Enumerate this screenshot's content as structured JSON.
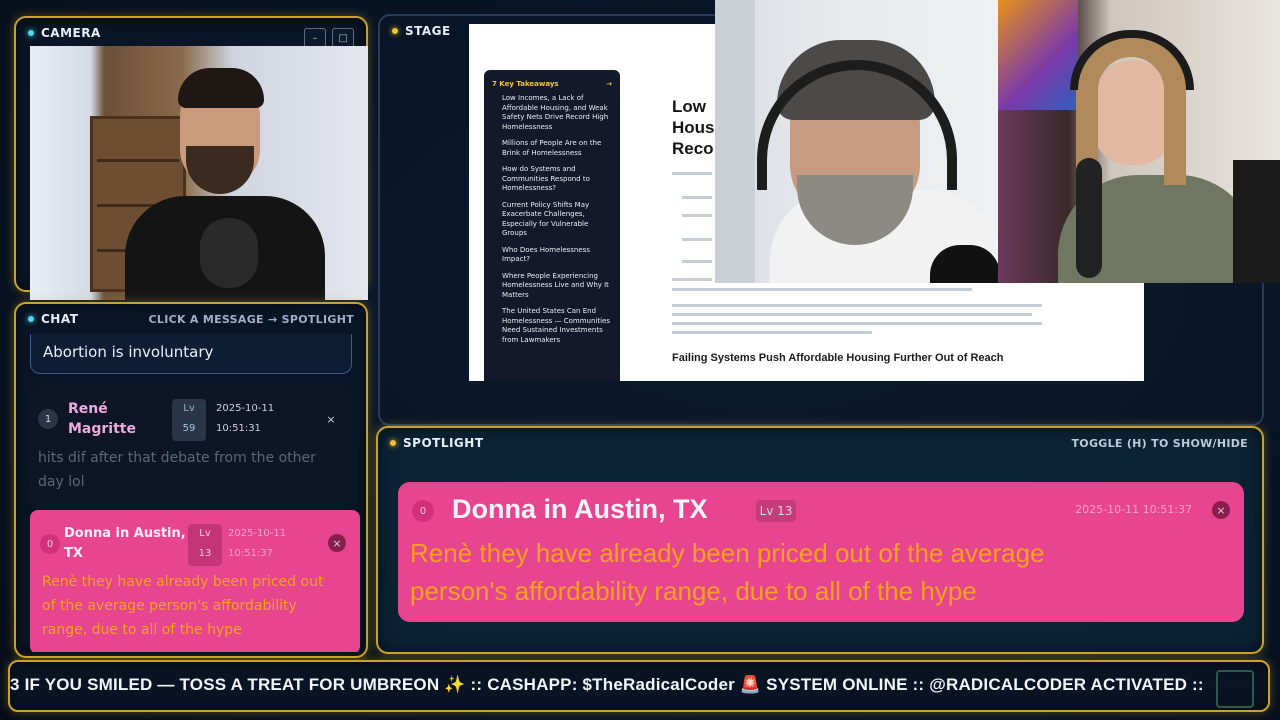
{
  "camera": {
    "title": "CAMERA",
    "minimize": "–",
    "maximize": "□"
  },
  "stage": {
    "title": "STAGE",
    "doc": {
      "toc_title": "7 Key Takeaways",
      "toc_arrow": "→",
      "toc_items": [
        "Low Incomes, a Lack of Affordable Housing, and Weak Safety Nets Drive Record High Homelessness",
        "Millions of People Are on the Brink of Homelessness",
        "How do Systems and Communities Respond to Homelessness?",
        "Current Policy Shifts May Exacerbate Challenges, Especially for Vulnerable Groups",
        "Who Does Homelessness Impact?",
        "Where People Experiencing Homelessness Live and Why It Matters",
        "The United States Can End Homelessness — Communities Need Sustained Investments from Lawmakers"
      ],
      "heading_lines": [
        "Low",
        "Hous",
        "Reco"
      ],
      "subheading": "Failing Systems Push Affordable Housing Further Out of Reach"
    }
  },
  "chat": {
    "title": "CHAT",
    "hint": "CLICK A MESSAGE → SPOTLIGHT",
    "pinned": "Abortion is involuntary",
    "messages": [
      {
        "index": "1",
        "name_line1": "René",
        "name_line2": "Magritte",
        "lv_label": "Lv",
        "lv_value": "59",
        "date": "2025-10-11",
        "time": "10:51:31",
        "close": "×",
        "text_line1": "hits dif after that debate from the other",
        "text_line2": "day lol"
      },
      {
        "index": "0",
        "name_line1": "Donna in Austin,",
        "name_line2": "TX",
        "lv_label": "Lv",
        "lv_value": "13",
        "date": "2025-10-11",
        "time": "10:51:37",
        "close": "×",
        "text_line1": "Renè they have already been priced out",
        "text_line2": "of the average person's affordability",
        "text_line3": "range, due to all of the hype"
      }
    ]
  },
  "spotlight": {
    "title": "SPOTLIGHT",
    "toggle_hint": "TOGGLE (H) TO SHOW/HIDE",
    "card": {
      "index": "0",
      "name": "Donna in Austin, TX",
      "level": "Lv 13",
      "timestamp": "2025-10-11 10:51:37",
      "close": "×",
      "text_line1": "Renè they have already been priced out of the average",
      "text_line2": "person's affordability range, due to all of the hype"
    }
  },
  "ticker": {
    "text": "3 IF YOU SMILED — TOSS A TREAT FOR UMBREON ✨ :: CASHAPP: $TheRadicalCoder     🚨 SYSTEM ONLINE :: @RADICALCODER ACTIVATED ::"
  },
  "colors": {
    "gold_border": "#c9a227",
    "pink_card": "#e84590",
    "orange_text": "#f7a21e",
    "cyan_accent": "#4fd6e8"
  }
}
